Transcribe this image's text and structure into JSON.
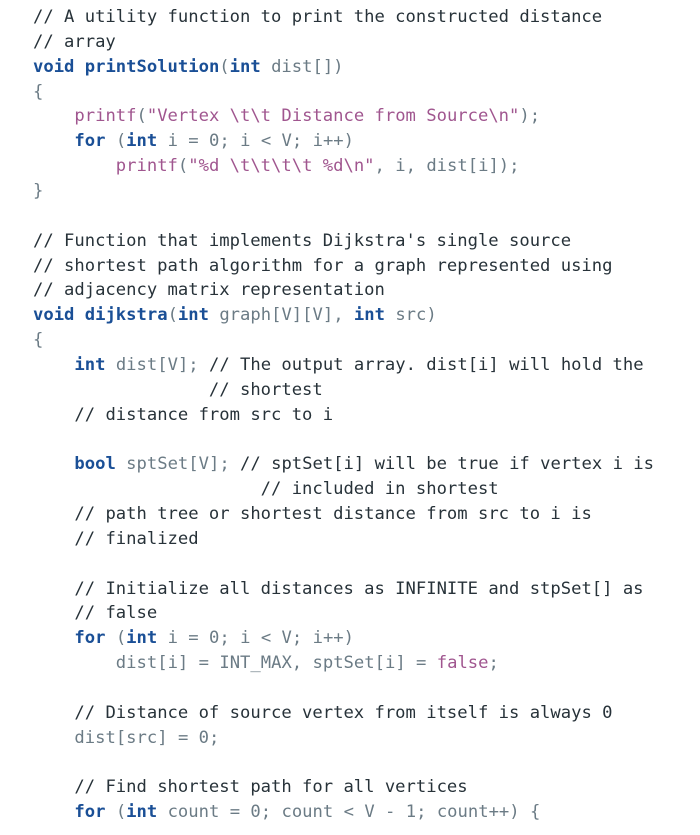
{
  "code": {
    "language": "c",
    "lines": [
      [
        {
          "t": "comment",
          "v": "// A utility function to print the constructed distance"
        }
      ],
      [
        {
          "t": "comment",
          "v": "// array"
        }
      ],
      [
        {
          "t": "keyword",
          "v": "void"
        },
        {
          "t": "plain",
          "v": " "
        },
        {
          "t": "func",
          "v": "printSolution"
        },
        {
          "t": "punct",
          "v": "("
        },
        {
          "t": "keyword",
          "v": "int"
        },
        {
          "t": "plain",
          "v": " "
        },
        {
          "t": "name",
          "v": "dist"
        },
        {
          "t": "punct",
          "v": "[])"
        }
      ],
      [
        {
          "t": "punct",
          "v": "{"
        }
      ],
      [
        {
          "t": "plain",
          "v": "    "
        },
        {
          "t": "string",
          "v": "printf"
        },
        {
          "t": "punct",
          "v": "("
        },
        {
          "t": "string",
          "v": "\"Vertex \\t\\t Distance from Source\\n\""
        },
        {
          "t": "punct",
          "v": ");"
        }
      ],
      [
        {
          "t": "plain",
          "v": "    "
        },
        {
          "t": "keyword",
          "v": "for"
        },
        {
          "t": "plain",
          "v": " "
        },
        {
          "t": "punct",
          "v": "("
        },
        {
          "t": "keyword",
          "v": "int"
        },
        {
          "t": "plain",
          "v": " "
        },
        {
          "t": "name",
          "v": "i"
        },
        {
          "t": "plain",
          "v": " "
        },
        {
          "t": "punct",
          "v": "="
        },
        {
          "t": "plain",
          "v": " "
        },
        {
          "t": "number",
          "v": "0"
        },
        {
          "t": "punct",
          "v": ";"
        },
        {
          "t": "plain",
          "v": " "
        },
        {
          "t": "name",
          "v": "i"
        },
        {
          "t": "plain",
          "v": " "
        },
        {
          "t": "punct",
          "v": "<"
        },
        {
          "t": "plain",
          "v": " "
        },
        {
          "t": "name",
          "v": "V"
        },
        {
          "t": "punct",
          "v": ";"
        },
        {
          "t": "plain",
          "v": " "
        },
        {
          "t": "name",
          "v": "i++"
        },
        {
          "t": "punct",
          "v": ")"
        }
      ],
      [
        {
          "t": "plain",
          "v": "        "
        },
        {
          "t": "string",
          "v": "printf"
        },
        {
          "t": "punct",
          "v": "("
        },
        {
          "t": "string",
          "v": "\"%d \\t\\t\\t\\t %d\\n\""
        },
        {
          "t": "punct",
          "v": ","
        },
        {
          "t": "plain",
          "v": " "
        },
        {
          "t": "name",
          "v": "i"
        },
        {
          "t": "punct",
          "v": ","
        },
        {
          "t": "plain",
          "v": " "
        },
        {
          "t": "name",
          "v": "dist"
        },
        {
          "t": "punct",
          "v": "["
        },
        {
          "t": "name",
          "v": "i"
        },
        {
          "t": "punct",
          "v": "]);"
        }
      ],
      [
        {
          "t": "punct",
          "v": "}"
        }
      ],
      [],
      [
        {
          "t": "comment",
          "v": "// Function that implements Dijkstra's single source"
        }
      ],
      [
        {
          "t": "comment",
          "v": "// shortest path algorithm for a graph represented using"
        }
      ],
      [
        {
          "t": "comment",
          "v": "// adjacency matrix representation"
        }
      ],
      [
        {
          "t": "keyword",
          "v": "void"
        },
        {
          "t": "plain",
          "v": " "
        },
        {
          "t": "func",
          "v": "dijkstra"
        },
        {
          "t": "punct",
          "v": "("
        },
        {
          "t": "keyword",
          "v": "int"
        },
        {
          "t": "plain",
          "v": " "
        },
        {
          "t": "name",
          "v": "graph"
        },
        {
          "t": "punct",
          "v": "["
        },
        {
          "t": "name",
          "v": "V"
        },
        {
          "t": "punct",
          "v": "]["
        },
        {
          "t": "name",
          "v": "V"
        },
        {
          "t": "punct",
          "v": "],"
        },
        {
          "t": "plain",
          "v": " "
        },
        {
          "t": "keyword",
          "v": "int"
        },
        {
          "t": "plain",
          "v": " "
        },
        {
          "t": "name",
          "v": "src"
        },
        {
          "t": "punct",
          "v": ")"
        }
      ],
      [
        {
          "t": "punct",
          "v": "{"
        }
      ],
      [
        {
          "t": "plain",
          "v": "    "
        },
        {
          "t": "keyword",
          "v": "int"
        },
        {
          "t": "plain",
          "v": " "
        },
        {
          "t": "name",
          "v": "dist"
        },
        {
          "t": "punct",
          "v": "["
        },
        {
          "t": "name",
          "v": "V"
        },
        {
          "t": "punct",
          "v": "];"
        },
        {
          "t": "plain",
          "v": " "
        },
        {
          "t": "comment",
          "v": "// The output array. dist[i] will hold the"
        }
      ],
      [
        {
          "t": "plain",
          "v": "                 "
        },
        {
          "t": "comment",
          "v": "// shortest"
        }
      ],
      [
        {
          "t": "plain",
          "v": "    "
        },
        {
          "t": "comment",
          "v": "// distance from src to i"
        }
      ],
      [],
      [
        {
          "t": "plain",
          "v": "    "
        },
        {
          "t": "keyword",
          "v": "bool"
        },
        {
          "t": "plain",
          "v": " "
        },
        {
          "t": "name",
          "v": "sptSet"
        },
        {
          "t": "punct",
          "v": "["
        },
        {
          "t": "name",
          "v": "V"
        },
        {
          "t": "punct",
          "v": "];"
        },
        {
          "t": "plain",
          "v": " "
        },
        {
          "t": "comment",
          "v": "// sptSet[i] will be true if vertex i is"
        }
      ],
      [
        {
          "t": "plain",
          "v": "                      "
        },
        {
          "t": "comment",
          "v": "// included in shortest"
        }
      ],
      [
        {
          "t": "plain",
          "v": "    "
        },
        {
          "t": "comment",
          "v": "// path tree or shortest distance from src to i is"
        }
      ],
      [
        {
          "t": "plain",
          "v": "    "
        },
        {
          "t": "comment",
          "v": "// finalized"
        }
      ],
      [],
      [
        {
          "t": "plain",
          "v": "    "
        },
        {
          "t": "comment",
          "v": "// Initialize all distances as INFINITE and stpSet[] as"
        }
      ],
      [
        {
          "t": "plain",
          "v": "    "
        },
        {
          "t": "comment",
          "v": "// false"
        }
      ],
      [
        {
          "t": "plain",
          "v": "    "
        },
        {
          "t": "keyword",
          "v": "for"
        },
        {
          "t": "plain",
          "v": " "
        },
        {
          "t": "punct",
          "v": "("
        },
        {
          "t": "keyword",
          "v": "int"
        },
        {
          "t": "plain",
          "v": " "
        },
        {
          "t": "name",
          "v": "i"
        },
        {
          "t": "plain",
          "v": " "
        },
        {
          "t": "punct",
          "v": "="
        },
        {
          "t": "plain",
          "v": " "
        },
        {
          "t": "number",
          "v": "0"
        },
        {
          "t": "punct",
          "v": ";"
        },
        {
          "t": "plain",
          "v": " "
        },
        {
          "t": "name",
          "v": "i"
        },
        {
          "t": "plain",
          "v": " "
        },
        {
          "t": "punct",
          "v": "<"
        },
        {
          "t": "plain",
          "v": " "
        },
        {
          "t": "name",
          "v": "V"
        },
        {
          "t": "punct",
          "v": ";"
        },
        {
          "t": "plain",
          "v": " "
        },
        {
          "t": "name",
          "v": "i++"
        },
        {
          "t": "punct",
          "v": ")"
        }
      ],
      [
        {
          "t": "plain",
          "v": "        "
        },
        {
          "t": "name",
          "v": "dist"
        },
        {
          "t": "punct",
          "v": "["
        },
        {
          "t": "name",
          "v": "i"
        },
        {
          "t": "punct",
          "v": "]"
        },
        {
          "t": "plain",
          "v": " "
        },
        {
          "t": "punct",
          "v": "="
        },
        {
          "t": "plain",
          "v": " "
        },
        {
          "t": "name",
          "v": "INT_MAX"
        },
        {
          "t": "punct",
          "v": ","
        },
        {
          "t": "plain",
          "v": " "
        },
        {
          "t": "name",
          "v": "sptSet"
        },
        {
          "t": "punct",
          "v": "["
        },
        {
          "t": "name",
          "v": "i"
        },
        {
          "t": "punct",
          "v": "]"
        },
        {
          "t": "plain",
          "v": " "
        },
        {
          "t": "punct",
          "v": "="
        },
        {
          "t": "plain",
          "v": " "
        },
        {
          "t": "string",
          "v": "false"
        },
        {
          "t": "punct",
          "v": ";"
        }
      ],
      [],
      [
        {
          "t": "plain",
          "v": "    "
        },
        {
          "t": "comment",
          "v": "// Distance of source vertex from itself is always 0"
        }
      ],
      [
        {
          "t": "plain",
          "v": "    "
        },
        {
          "t": "name",
          "v": "dist"
        },
        {
          "t": "punct",
          "v": "["
        },
        {
          "t": "name",
          "v": "src"
        },
        {
          "t": "punct",
          "v": "]"
        },
        {
          "t": "plain",
          "v": " "
        },
        {
          "t": "punct",
          "v": "="
        },
        {
          "t": "plain",
          "v": " "
        },
        {
          "t": "number",
          "v": "0"
        },
        {
          "t": "punct",
          "v": ";"
        }
      ],
      [],
      [
        {
          "t": "plain",
          "v": "    "
        },
        {
          "t": "comment",
          "v": "// Find shortest path for all vertices"
        }
      ],
      [
        {
          "t": "plain",
          "v": "    "
        },
        {
          "t": "keyword",
          "v": "for"
        },
        {
          "t": "plain",
          "v": " "
        },
        {
          "t": "punct",
          "v": "("
        },
        {
          "t": "keyword",
          "v": "int"
        },
        {
          "t": "plain",
          "v": " "
        },
        {
          "t": "name",
          "v": "count"
        },
        {
          "t": "plain",
          "v": " "
        },
        {
          "t": "punct",
          "v": "="
        },
        {
          "t": "plain",
          "v": " "
        },
        {
          "t": "number",
          "v": "0"
        },
        {
          "t": "punct",
          "v": ";"
        },
        {
          "t": "plain",
          "v": " "
        },
        {
          "t": "name",
          "v": "count"
        },
        {
          "t": "plain",
          "v": " "
        },
        {
          "t": "punct",
          "v": "<"
        },
        {
          "t": "plain",
          "v": " "
        },
        {
          "t": "name",
          "v": "V"
        },
        {
          "t": "plain",
          "v": " "
        },
        {
          "t": "punct",
          "v": "-"
        },
        {
          "t": "plain",
          "v": " "
        },
        {
          "t": "number",
          "v": "1"
        },
        {
          "t": "punct",
          "v": ";"
        },
        {
          "t": "plain",
          "v": " "
        },
        {
          "t": "name",
          "v": "count++"
        },
        {
          "t": "punct",
          "v": ")"
        },
        {
          "t": "plain",
          "v": " "
        },
        {
          "t": "punct",
          "v": "{"
        }
      ]
    ]
  }
}
